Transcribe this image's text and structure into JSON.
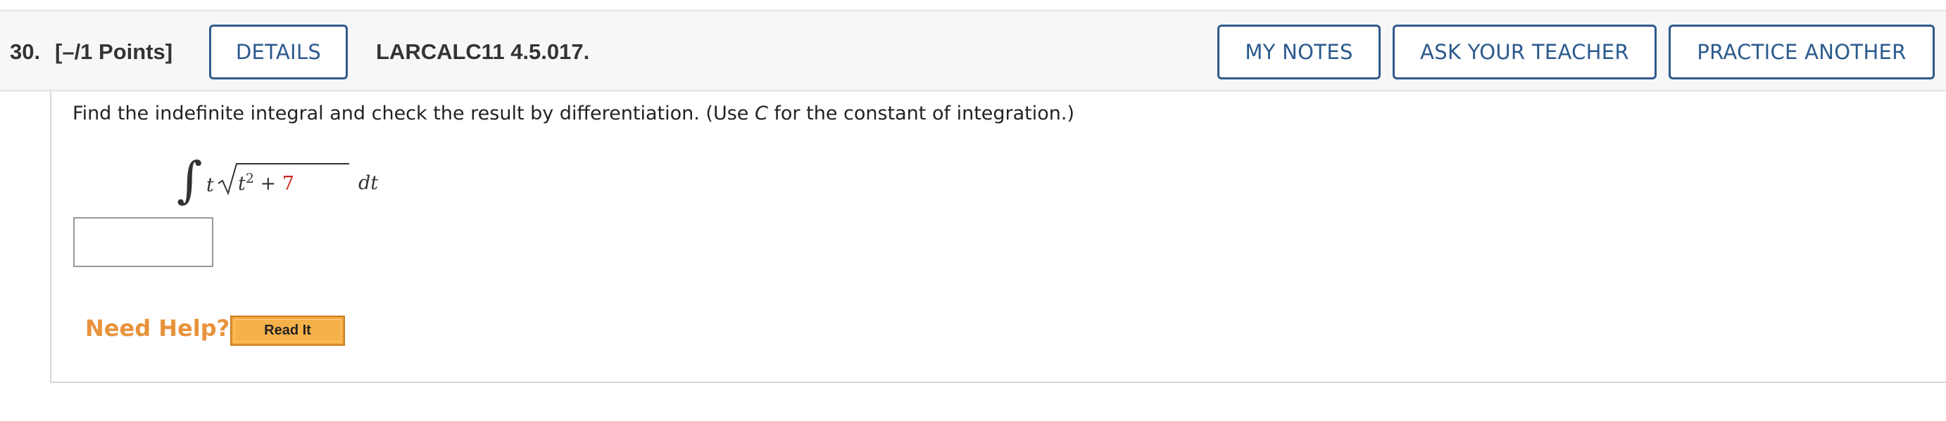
{
  "question": {
    "number": "30.",
    "points": "[–/1 Points]",
    "details_label": "DETAILS",
    "code": "LARCALC11 4.5.017.",
    "my_notes_label": "MY NOTES",
    "ask_teacher_label": "ASK YOUR TEACHER",
    "practice_another_label": "PRACTICE ANOTHER"
  },
  "prompt": {
    "before_var": "Find the indefinite integral and check the result by differentiation. (Use ",
    "var": "C",
    "after_var": " for the constant of integration.)"
  },
  "math": {
    "integral_symbol": "∫",
    "factor": "t",
    "radicand_base": "t",
    "radicand_exponent": "2",
    "radicand_operator": " + ",
    "radicand_constant": "7",
    "differential": "dt"
  },
  "answer": {
    "value": ""
  },
  "help": {
    "label": "Need Help?",
    "read_it_label": "Read It"
  },
  "colors": {
    "button_blue": "#2b5a8e",
    "help_orange": "#e8933c",
    "constant_red": "#c0281f",
    "read_it_fill": "#f6b24a"
  }
}
